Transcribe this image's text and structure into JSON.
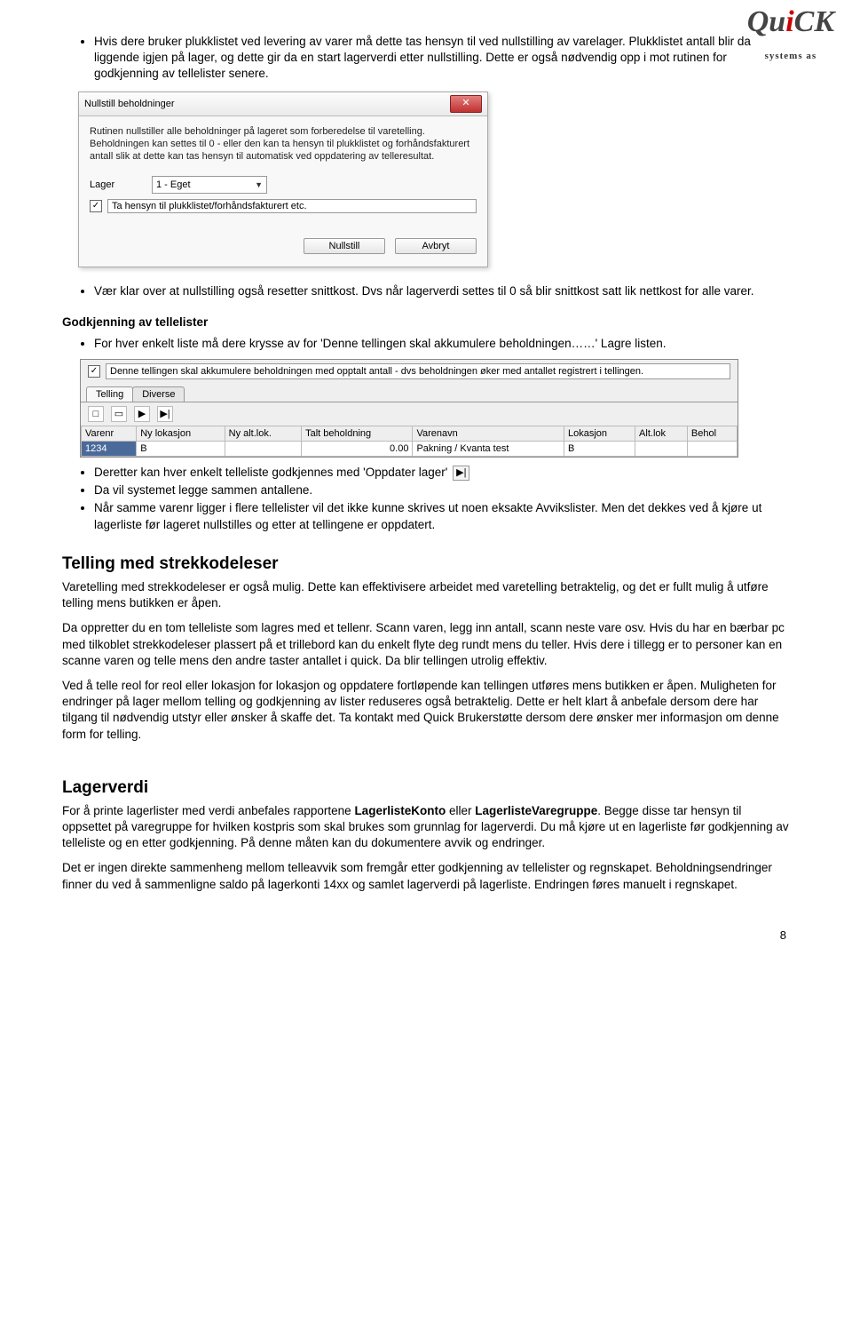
{
  "logo": {
    "prefix": "Qu",
    "mid": "i",
    "suffix": "CK",
    "sub": "systems as"
  },
  "top_bullets": [
    "Hvis dere bruker plukklistet ved levering av varer må dette tas hensyn til ved nullstilling av varelager.  Plukklistet antall blir da liggende igjen på lager, og dette gir da en start lagerverdi etter nullstilling.  Dette er også nødvendig opp i mot rutinen for godkjenning av tellelister senere."
  ],
  "dialog": {
    "title": "Nullstill beholdninger",
    "info1": "Rutinen nullstiller alle beholdninger på lageret som forberedelse til varetelling.",
    "info2": "Beholdningen kan settes til 0 - eller den kan ta hensyn til plukklistet og forhåndsfakturert antall slik at dette kan tas hensyn til automatisk ved oppdatering av telleresultat.",
    "lager_label": "Lager",
    "lager_value": "1 - Eget",
    "checkbox_label": "Ta hensyn til plukklistet/forhåndsfakturert etc.",
    "btn_ok": "Nullstill",
    "btn_cancel": "Avbryt"
  },
  "mid_bullets": [
    "Vær klar over at nullstilling også resetter snittkost.  Dvs når lagerverdi settes til 0 så blir snittkost satt lik nettkost for alle varer."
  ],
  "godkjenning_title": "Godkjenning av tellelister",
  "godkjenning_bullets": [
    "For hver enkelt liste må dere krysse av for 'Denne tellingen skal akkumulere beholdningen……' Lagre listen."
  ],
  "panel2": {
    "checkbox_text": "Denne tellingen skal akkumulere beholdningen med opptalt antall - dvs beholdningen øker med antallet registrert i tellingen.",
    "tab1": "Telling",
    "tab2": "Diverse",
    "cols": [
      "Varenr",
      "Ny lokasjon",
      "Ny alt.lok.",
      "Talt beholdning",
      "Varenavn",
      "Lokasjon",
      "Alt.lok",
      "Behol"
    ],
    "row": {
      "varenr": "1234",
      "nylok": "B",
      "nyalt": "",
      "talt": "0.00",
      "navn": "Pakning / Kvanta test",
      "lok": "B",
      "altlok": "",
      "beh": ""
    }
  },
  "after_bullets": [
    "Deretter kan hver enkelt telleliste godkjennes med 'Oppdater lager'",
    "Da vil systemet legge sammen antallene.",
    "Når samme varenr ligger i flere tellelister vil det ikke kunne skrives ut noen eksakte Avvikslister.  Men det dekkes ved å kjøre ut lagerliste før lageret nullstilles og etter at tellingene er oppdatert."
  ],
  "section2_title": "Telling med strekkodeleser",
  "section2_para1": "Varetelling med strekkodeleser er også mulig.  Dette kan effektivisere arbeidet med varetelling betraktelig, og det er fullt mulig å utføre telling mens butikken er åpen.",
  "section2_para2": "Da oppretter du en tom telleliste som lagres med et tellenr.  Scann varen, legg inn antall, scann neste vare osv. Hvis du har en bærbar pc med tilkoblet strekkodeleser plassert på et trillebord kan du enkelt flyte deg rundt mens du teller.  Hvis dere i tillegg er to personer kan en scanne varen og telle mens den andre taster antallet i quick. Da blir tellingen utrolig effektiv.",
  "section2_para3": "Ved å telle reol for reol eller lokasjon for lokasjon og oppdatere fortløpende kan tellingen utføres mens butikken er åpen.  Muligheten for endringer på lager mellom telling og godkjenning av lister reduseres også betraktelig.  Dette er helt klart å anbefale dersom dere har tilgang til nødvendig utstyr eller ønsker å skaffe det.  Ta kontakt med Quick Brukerstøtte dersom dere ønsker mer informasjon om denne form for telling.",
  "section3_title": "Lagerverdi",
  "section3_para1a": "For å printe lagerlister med verdi anbefales rapportene ",
  "section3_bold1": "LagerlisteKonto",
  "section3_mid": " eller ",
  "section3_bold2": "LagerlisteVaregruppe",
  "section3_para1b": ".  Begge disse tar hensyn til oppsettet på varegruppe for hvilken kostpris som skal brukes som grunnlag for lagerverdi.  Du må kjøre ut en lagerliste før godkjenning av telleliste og en etter godkjenning.  På denne måten kan du dokumentere avvik og endringer.",
  "section3_para2": "Det er ingen direkte sammenheng mellom telleavvik som fremgår etter godkjenning av tellelister og regnskapet. Beholdningsendringer finner du ved å sammenligne saldo på lagerkonti 14xx og samlet lagerverdi på lagerliste. Endringen føres manuelt i regnskapet.",
  "page_number": "8"
}
